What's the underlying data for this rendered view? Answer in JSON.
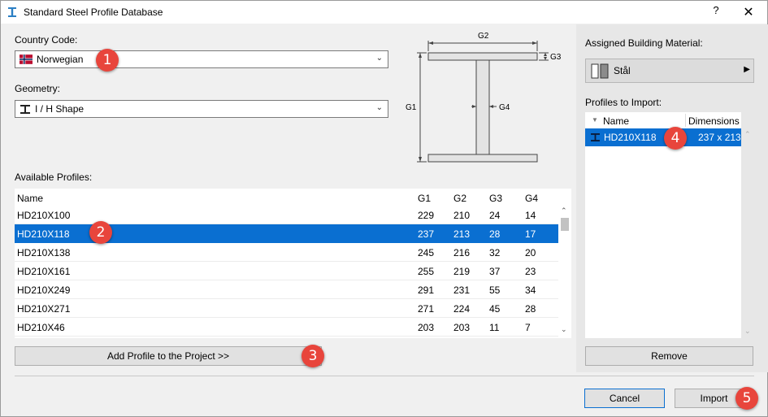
{
  "window": {
    "title": "Standard Steel Profile Database",
    "help_label": "?",
    "close_label": "✕"
  },
  "country": {
    "label": "Country Code:",
    "value": "Norwegian"
  },
  "geometry": {
    "label": "Geometry:",
    "value": "I / H Shape"
  },
  "diagram": {
    "labels": {
      "g1": "G1",
      "g2": "G2",
      "g3": "G3",
      "g4": "G4"
    }
  },
  "available": {
    "label": "Available Profiles:",
    "columns": [
      "Name",
      "G1",
      "G2",
      "G3",
      "G4"
    ],
    "rows": [
      {
        "name": "HD210X100",
        "g1": "229",
        "g2": "210",
        "g3": "24",
        "g4": "14",
        "selected": false
      },
      {
        "name": "HD210X118",
        "g1": "237",
        "g2": "213",
        "g3": "28",
        "g4": "17",
        "selected": true
      },
      {
        "name": "HD210X138",
        "g1": "245",
        "g2": "216",
        "g3": "32",
        "g4": "20",
        "selected": false
      },
      {
        "name": "HD210X161",
        "g1": "255",
        "g2": "219",
        "g3": "37",
        "g4": "23",
        "selected": false
      },
      {
        "name": "HD210X249",
        "g1": "291",
        "g2": "231",
        "g3": "55",
        "g4": "34",
        "selected": false
      },
      {
        "name": "HD210X271",
        "g1": "271",
        "g2": "224",
        "g3": "45",
        "g4": "28",
        "selected": false
      },
      {
        "name": "HD210X46",
        "g1": "203",
        "g2": "203",
        "g3": "11",
        "g4": "7",
        "selected": false
      }
    ]
  },
  "add_button": "Add Profile to the Project >>",
  "material": {
    "label": "Assigned Building Material:",
    "value": "Stål"
  },
  "import_list": {
    "label": "Profiles to Import:",
    "columns": [
      "Name",
      "Dimensions"
    ],
    "rows": [
      {
        "name": "HD210X118",
        "dimensions": "237 x 213"
      }
    ]
  },
  "remove_button": "Remove",
  "cancel_button": "Cancel",
  "import_button": "Import",
  "badges": [
    "1",
    "2",
    "3",
    "4",
    "5"
  ],
  "colors": {
    "selection": "#0a6fd1",
    "badge": "#e8453c"
  }
}
